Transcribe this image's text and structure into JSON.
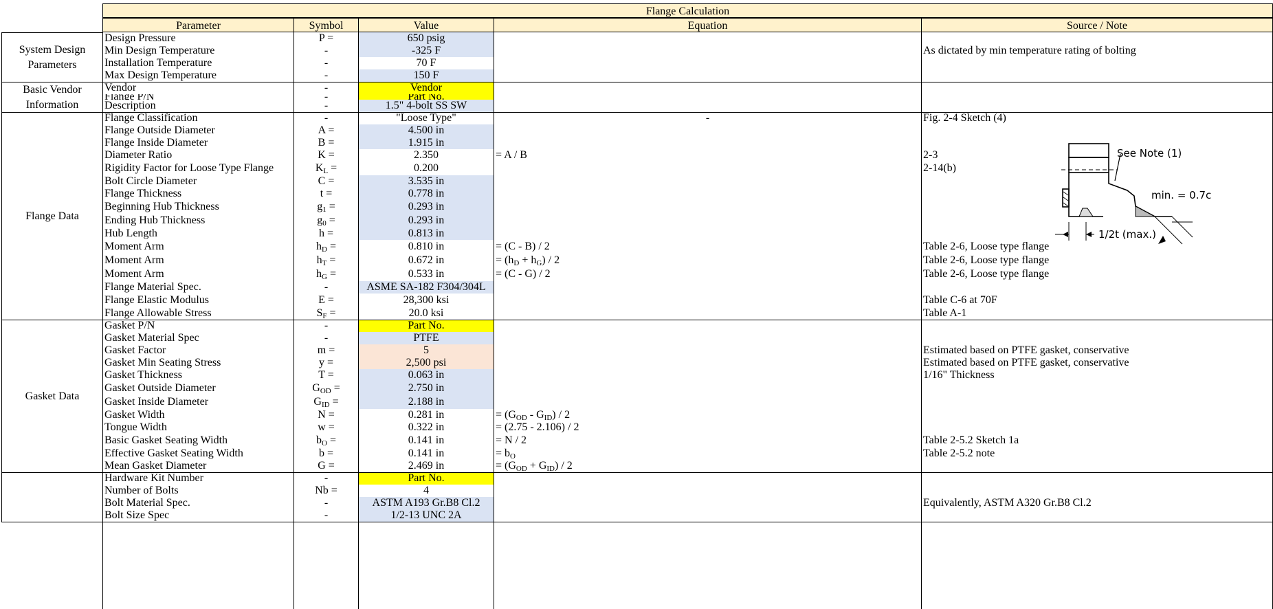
{
  "title": "Flange Calculation",
  "headers": {
    "parameter": "Parameter",
    "symbol": "Symbol",
    "value": "Value",
    "equation": "Equation",
    "source": "Source / Note"
  },
  "groups": [
    {
      "label": "System Design Parameters"
    },
    {
      "label": "Basic Vendor Information"
    },
    {
      "label": "Flange Data"
    },
    {
      "label": "Gasket Data"
    },
    {
      "label": ""
    }
  ],
  "rows": [
    {
      "param": "Design Pressure",
      "sym": "P =",
      "sub": "",
      "symtail": "",
      "value": "650 psig",
      "bg": "blue",
      "eq": "",
      "note": ""
    },
    {
      "param": "Min Design Temperature",
      "sym": "-",
      "sub": "",
      "symtail": "",
      "value": "-325 F",
      "bg": "blue",
      "eq": "",
      "note": "As dictated by min temperature rating of bolting"
    },
    {
      "param": "Installation Temperature",
      "sym": "-",
      "sub": "",
      "symtail": "",
      "value": "70 F",
      "bg": "none",
      "eq": "",
      "note": ""
    },
    {
      "param": "Max Design Temperature",
      "sym": "-",
      "sub": "",
      "symtail": "",
      "value": "150 F",
      "bg": "blue",
      "eq": "",
      "note": ""
    },
    {
      "param": "Vendor",
      "sym": "-",
      "sub": "",
      "symtail": "",
      "value": "Vendor",
      "bg": "yellow",
      "eq": "",
      "note": ""
    },
    {
      "param": "Flange P/N",
      "sym": "-",
      "sub": "",
      "symtail": "",
      "value": "Part No.",
      "bg": "yellow",
      "eq": "",
      "note": ""
    },
    {
      "param": "Description",
      "sym": "-",
      "sub": "",
      "symtail": "",
      "value": "1.5\" 4-bolt SS SW",
      "bg": "blue",
      "eq": "",
      "note": ""
    },
    {
      "param": "Flange Classification",
      "sym": "-",
      "sub": "",
      "symtail": "",
      "value": "\"Loose Type\"",
      "bg": "none",
      "eq": "-",
      "note": "Fig. 2-4 Sketch (4)"
    },
    {
      "param": "Flange Outside Diameter",
      "sym": "A =",
      "sub": "",
      "symtail": "",
      "value": "4.500 in",
      "bg": "blue",
      "eq": "",
      "note": ""
    },
    {
      "param": "Flange Inside Diameter",
      "sym": "B =",
      "sub": "",
      "symtail": "",
      "value": "1.915 in",
      "bg": "blue",
      "eq": "",
      "note": ""
    },
    {
      "param": "Diameter Ratio",
      "sym": "K =",
      "sub": "",
      "symtail": "",
      "value": "2.350",
      "bg": "none",
      "eq": "= A / B",
      "note": "2-3"
    },
    {
      "param": "Rigidity Factor for Loose Type Flange",
      "sym": "K",
      "sub": "L",
      "symtail": " =",
      "value": "0.200",
      "bg": "none",
      "eq": "",
      "note": "2-14(b)"
    },
    {
      "param": "Bolt Circle Diameter",
      "sym": "C =",
      "sub": "",
      "symtail": "",
      "value": "3.535 in",
      "bg": "blue",
      "eq": "",
      "note": ""
    },
    {
      "param": "Flange Thickness",
      "sym": "t =",
      "sub": "",
      "symtail": "",
      "value": "0.778 in",
      "bg": "blue",
      "eq": "",
      "note": ""
    },
    {
      "param": "Beginning Hub Thickness",
      "sym": "g",
      "sub": "1",
      "symtail": " =",
      "value": "0.293 in",
      "bg": "blue",
      "eq": "",
      "note": ""
    },
    {
      "param": "Ending Hub Thickness",
      "sym": "g",
      "sub": "0",
      "symtail": " =",
      "value": "0.293 in",
      "bg": "blue",
      "eq": "",
      "note": ""
    },
    {
      "param": "Hub Length",
      "sym": "h =",
      "sub": "",
      "symtail": "",
      "value": "0.813 in",
      "bg": "blue",
      "eq": "",
      "note": ""
    },
    {
      "param": "Moment Arm",
      "sym": "h",
      "sub": "D",
      "symtail": " =",
      "value": "0.810 in",
      "bg": "none",
      "eq": "= (C - B) / 2",
      "note": "Table 2-6, Loose type flange"
    },
    {
      "param": "Moment Arm",
      "sym": "h",
      "sub": "T",
      "symtail": " =",
      "value": "0.672 in",
      "bg": "none",
      "eq": "= (h_D + h_G) / 2",
      "note": "Table 2-6, Loose type flange"
    },
    {
      "param": "Moment Arm",
      "sym": "h",
      "sub": "G",
      "symtail": " =",
      "value": "0.533 in",
      "bg": "none",
      "eq": "= (C - G) / 2",
      "note": "Table 2-6, Loose type flange"
    },
    {
      "param": "Flange Material Spec.",
      "sym": "-",
      "sub": "",
      "symtail": "",
      "value": "ASME SA-182 F304/304L",
      "bg": "blue",
      "eq": "",
      "note": ""
    },
    {
      "param": "Flange Elastic Modulus",
      "sym": "E =",
      "sub": "",
      "symtail": "",
      "value": "28,300 ksi",
      "bg": "none",
      "eq": "",
      "note": "Table C-6 at 70F"
    },
    {
      "param": "Flange Allowable Stress",
      "sym": "S",
      "sub": "F",
      "symtail": " =",
      "value": "20.0 ksi",
      "bg": "none",
      "eq": "",
      "note": "Table A-1"
    },
    {
      "param": "Gasket P/N",
      "sym": "-",
      "sub": "",
      "symtail": "",
      "value": "Part No.",
      "bg": "yellow",
      "eq": "",
      "note": ""
    },
    {
      "param": "Gasket Material Spec",
      "sym": "-",
      "sub": "",
      "symtail": "",
      "value": "PTFE",
      "bg": "blue",
      "eq": "",
      "note": ""
    },
    {
      "param": "Gasket Factor",
      "sym": "m =",
      "sub": "",
      "symtail": "",
      "value": "5",
      "bg": "peach",
      "eq": "",
      "note": "Estimated based on PTFE gasket, conservative"
    },
    {
      "param": "Gasket Min Seating Stress",
      "sym": "y =",
      "sub": "",
      "symtail": "",
      "value": "2,500 psi",
      "bg": "peach",
      "eq": "",
      "note": "Estimated based on PTFE gasket, conservative"
    },
    {
      "param": "Gasket Thickness",
      "sym": "T =",
      "sub": "",
      "symtail": "",
      "value": "0.063 in",
      "bg": "blue",
      "eq": "",
      "note": "1/16\" Thickness"
    },
    {
      "param": "Gasket Outside Diameter",
      "sym": "G",
      "sub": "OD",
      "symtail": " =",
      "value": "2.750 in",
      "bg": "blue",
      "eq": "",
      "note": ""
    },
    {
      "param": "Gasket Inside Diameter",
      "sym": "G",
      "sub": "ID",
      "symtail": " =",
      "value": "2.188 in",
      "bg": "blue",
      "eq": "",
      "note": ""
    },
    {
      "param": "Gasket Width",
      "sym": "N =",
      "sub": "",
      "symtail": "",
      "value": "0.281 in",
      "bg": "none",
      "eq": "= (G_OD - G_ID) / 2",
      "note": ""
    },
    {
      "param": "Tongue Width",
      "sym": "w =",
      "sub": "",
      "symtail": "",
      "value": "0.322 in",
      "bg": "none",
      "eq": "= (2.75 - 2.106) / 2",
      "note": ""
    },
    {
      "param": "Basic Gasket Seating Width",
      "sym": "b",
      "sub": "O",
      "symtail": " =",
      "value": "0.141 in",
      "bg": "none",
      "eq": "= N / 2",
      "note": "Table 2-5.2 Sketch 1a"
    },
    {
      "param": "Effective Gasket Seating Width",
      "sym": "b =",
      "sub": "",
      "symtail": "",
      "value": "0.141 in",
      "bg": "none",
      "eq": "= b_O",
      "note": "Table 2-5.2 note"
    },
    {
      "param": "Mean Gasket Diameter",
      "sym": "G =",
      "sub": "",
      "symtail": "",
      "value": "2.469 in",
      "bg": "none",
      "eq": "= (G_OD + G_ID) / 2",
      "note": ""
    },
    {
      "param": "Hardware Kit Number",
      "sym": "-",
      "sub": "",
      "symtail": "",
      "value": "Part No.",
      "bg": "yellow",
      "eq": "",
      "note": ""
    },
    {
      "param": "Number of Bolts",
      "sym": "Nb =",
      "sub": "",
      "symtail": "",
      "value": "4",
      "bg": "none",
      "eq": "",
      "note": ""
    },
    {
      "param": "Bolt Material Spec.",
      "sym": "-",
      "sub": "",
      "symtail": "",
      "value": "ASTM A193 Gr.B8 Cl.2",
      "bg": "blue",
      "eq": "",
      "note": "Equivalently, ASTM A320 Gr.B8 Cl.2"
    },
    {
      "param": "Bolt Size Spec",
      "sym": "-",
      "sub": "",
      "symtail": "",
      "value": "1/2-13 UNC 2A",
      "bg": "blue",
      "eq": "",
      "note": ""
    }
  ],
  "sketch": {
    "note_label": "See Note (1)",
    "min_label": "min. = 0.7c",
    "half_t_label": "1/2t (max.)",
    "icon": "loose-flange-sketch"
  },
  "colors": {
    "header": "#fff2cc",
    "input_blue": "#dae3f3",
    "input_yellow": "#ffff00",
    "estimate_peach": "#fbe5d6"
  }
}
